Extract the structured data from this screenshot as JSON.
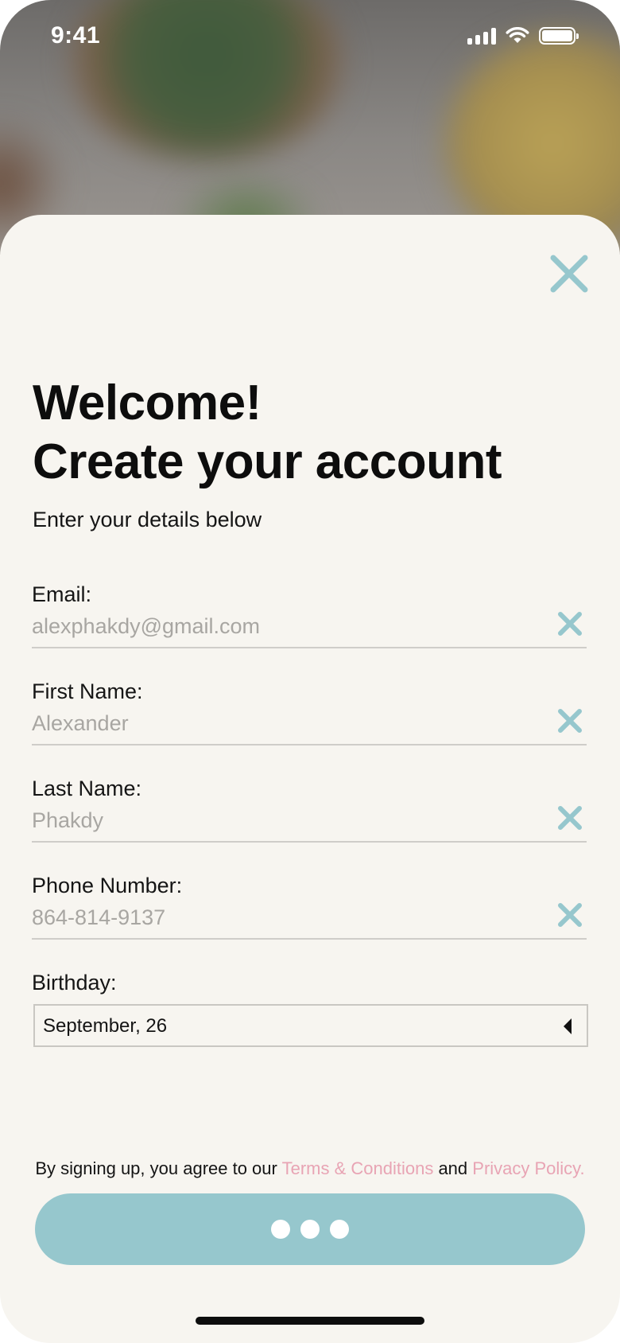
{
  "status_bar": {
    "time": "9:41"
  },
  "header": {
    "title_line1": "Welcome!",
    "title_line2": "Create your account",
    "subtitle": "Enter your details below"
  },
  "form": {
    "email": {
      "label": "Email:",
      "value": "alexphakdy@gmail.com"
    },
    "first_name": {
      "label": "First Name:",
      "value": "Alexander"
    },
    "last_name": {
      "label": "Last Name:",
      "value": "Phakdy"
    },
    "phone": {
      "label": "Phone Number:",
      "value": "864-814-9137"
    },
    "birthday": {
      "label": "Birthday:",
      "value": "September, 26"
    }
  },
  "legal": {
    "prefix": "By signing up, you agree to our ",
    "terms_link": "Terms & Conditions",
    "middle": " and ",
    "privacy_link": "Privacy Policy."
  },
  "colors": {
    "accent": "#96c7cd",
    "link": "#e8a4b4",
    "background": "#f7f5f0",
    "text": "#0d0d0d",
    "placeholder_text": "#a8a6a2"
  },
  "icons": {
    "close": "close-icon",
    "clear": "clear-x-icon",
    "caret": "caret-left-icon",
    "loading": "loading-dots-icon"
  }
}
